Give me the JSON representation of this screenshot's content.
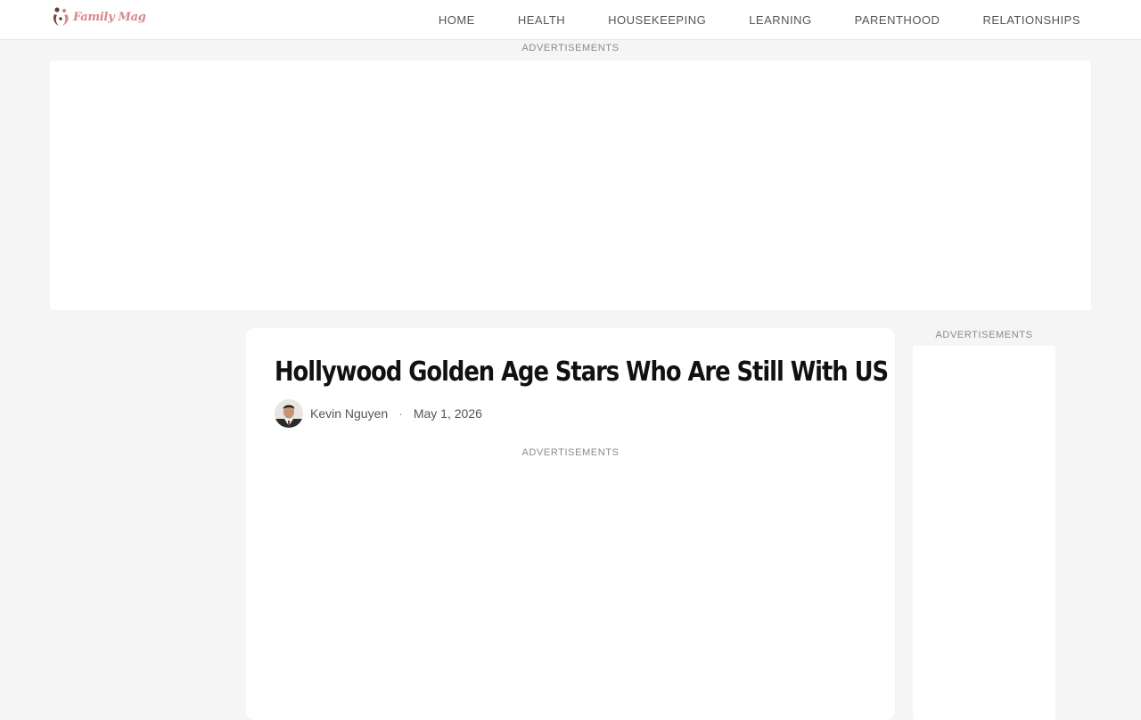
{
  "header": {
    "logo_text": "Family Mag",
    "logo_icon": "family-heart-icon",
    "nav": [
      "HOME",
      "HEALTH",
      "HOUSEKEEPING",
      "LEARNING",
      "PARENTHOOD",
      "RELATIONSHIPS"
    ]
  },
  "ads": {
    "top_label": "ADVERTISEMENTS",
    "article_label": "ADVERTISEMENTS",
    "sidebar_label": "ADVERTISEMENTS"
  },
  "article": {
    "title": "Hollywood Golden Age Stars Who Are Still With US",
    "author": "Kevin Nguyen",
    "separator": "·",
    "date": "May 1, 2026"
  },
  "colors": {
    "background": "#f5f5f5",
    "card": "#ffffff",
    "logo": "#d9888a",
    "logo_dark": "#6b3f36"
  }
}
